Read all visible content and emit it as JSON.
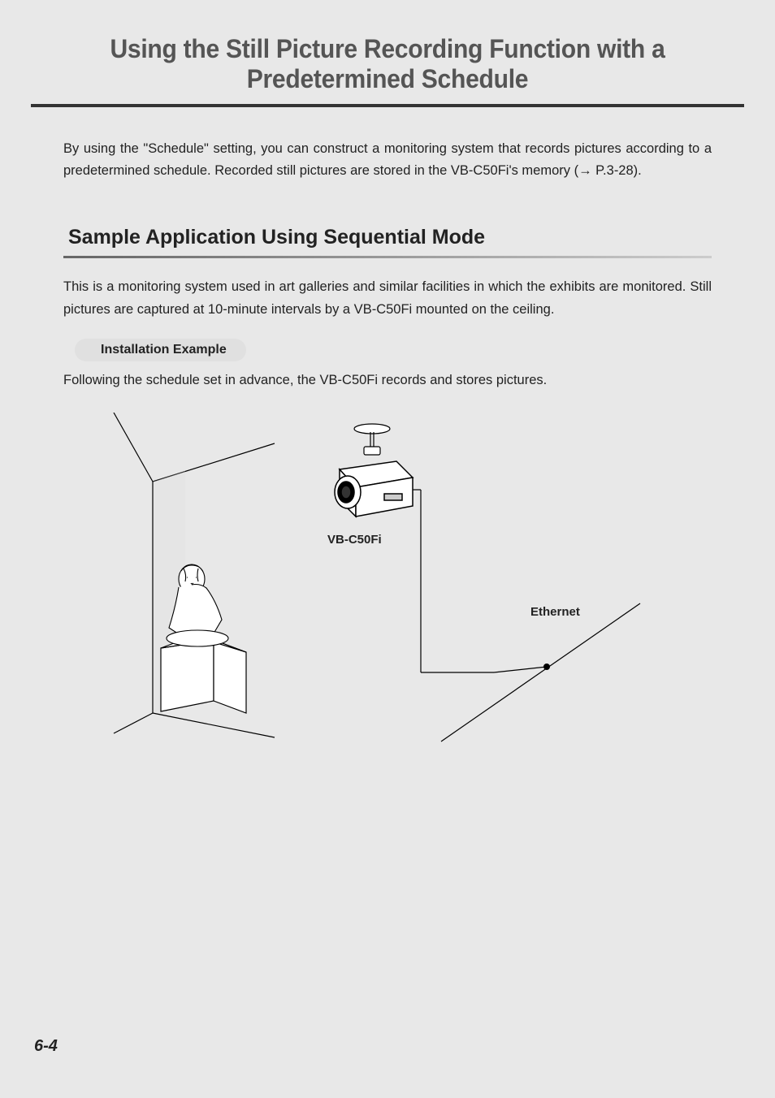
{
  "title": "Using the Still Picture Recording Function with a Predetermined Schedule",
  "intro": "By using the \"Schedule\" setting, you can construct a monitoring system that records pictures according to a predetermined schedule. Recorded still pictures are stored in the VB-C50Fi's memory (→ P.3-28).",
  "section": {
    "heading": "Sample Application Using Sequential Mode",
    "text": "This is a monitoring system used in art galleries and similar facilities in which the exhibits are monitored. Still pictures are captured at 10-minute intervals by a VB-C50Fi mounted on the ceiling."
  },
  "install": {
    "badge": "Installation Example",
    "text": "Following the schedule set in advance, the VB-C50Fi records and stores pictures."
  },
  "diagram": {
    "camera_label": "VB-C50Fi",
    "ethernet_label": "Ethernet"
  },
  "page_number": "6-4"
}
